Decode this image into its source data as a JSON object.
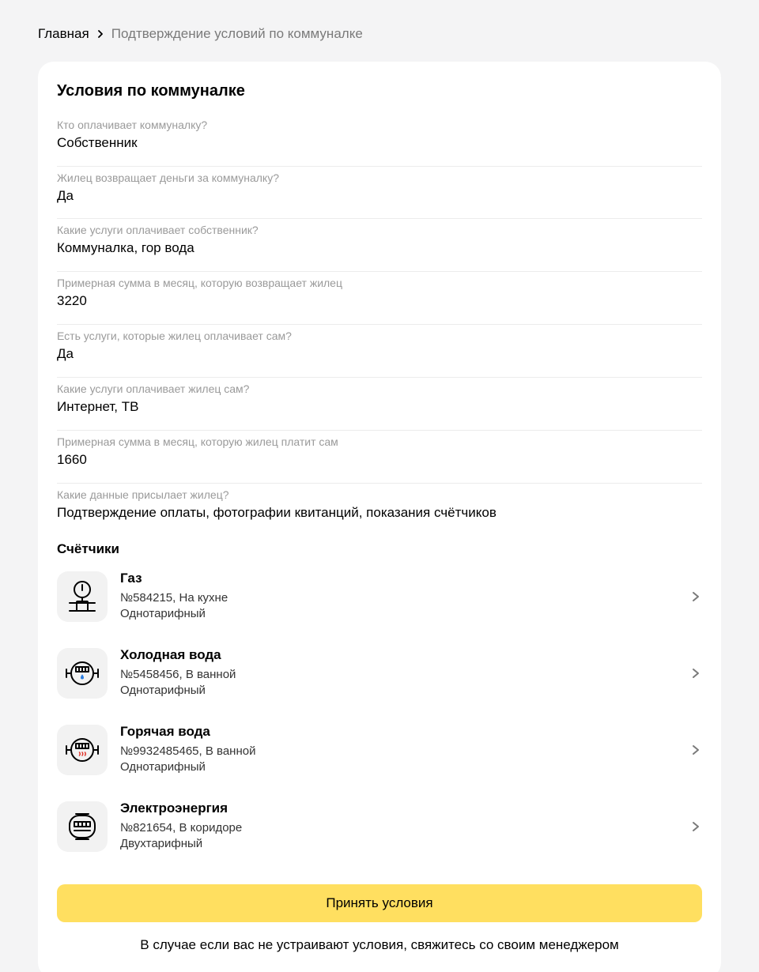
{
  "breadcrumb": {
    "home": "Главная",
    "current": "Подтверждение условий по коммуналке"
  },
  "card": {
    "title": "Условия по коммуналке",
    "fields": [
      {
        "label": "Кто оплачивает коммуналку?",
        "value": "Собственник"
      },
      {
        "label": "Жилец возвращает деньги за коммуналку?",
        "value": "Да"
      },
      {
        "label": "Какие услуги оплачивает собственник?",
        "value": "Коммуналка, гор вода"
      },
      {
        "label": "Примерная сумма в месяц, которую возвращает жилец",
        "value": "3220"
      },
      {
        "label": "Есть услуги, которые жилец оплачивает сам?",
        "value": "Да"
      },
      {
        "label": "Какие услуги оплачивает жилец сам?",
        "value": "Интернет, ТВ"
      },
      {
        "label": "Примерная сумма в месяц, которую жилец платит сам",
        "value": "1660"
      },
      {
        "label": "Какие данные присылает жилец?",
        "value": "Подтверждение оплаты, фотографии квитанций, показания счётчиков"
      }
    ]
  },
  "meters": {
    "title": "Счётчики",
    "items": [
      {
        "name": "Газ",
        "number_location": "№584215, На кухне",
        "tariff": "Однотарифный",
        "icon": "gas-meter-icon"
      },
      {
        "name": "Холодная вода",
        "number_location": "№5458456, В ванной",
        "tariff": "Однотарифный",
        "icon": "cold-water-meter-icon"
      },
      {
        "name": "Горячая вода",
        "number_location": "№9932485465, В ванной",
        "tariff": "Однотарифный",
        "icon": "hot-water-meter-icon"
      },
      {
        "name": "Электроэнергия",
        "number_location": "№821654, В коридоре",
        "tariff": "Двухтарифный",
        "icon": "electricity-meter-icon"
      }
    ]
  },
  "actions": {
    "accept_label": "Принять условия",
    "note": "В случае если вас не устраивают условия, свяжитесь со своим менеджером"
  },
  "colors": {
    "accent_button": "#ffdf60",
    "background": "#f4f4f5",
    "label_gray": "#9a9a9a",
    "hot_water_red": "#e0352b",
    "cold_water_blue": "#2b7de0"
  }
}
